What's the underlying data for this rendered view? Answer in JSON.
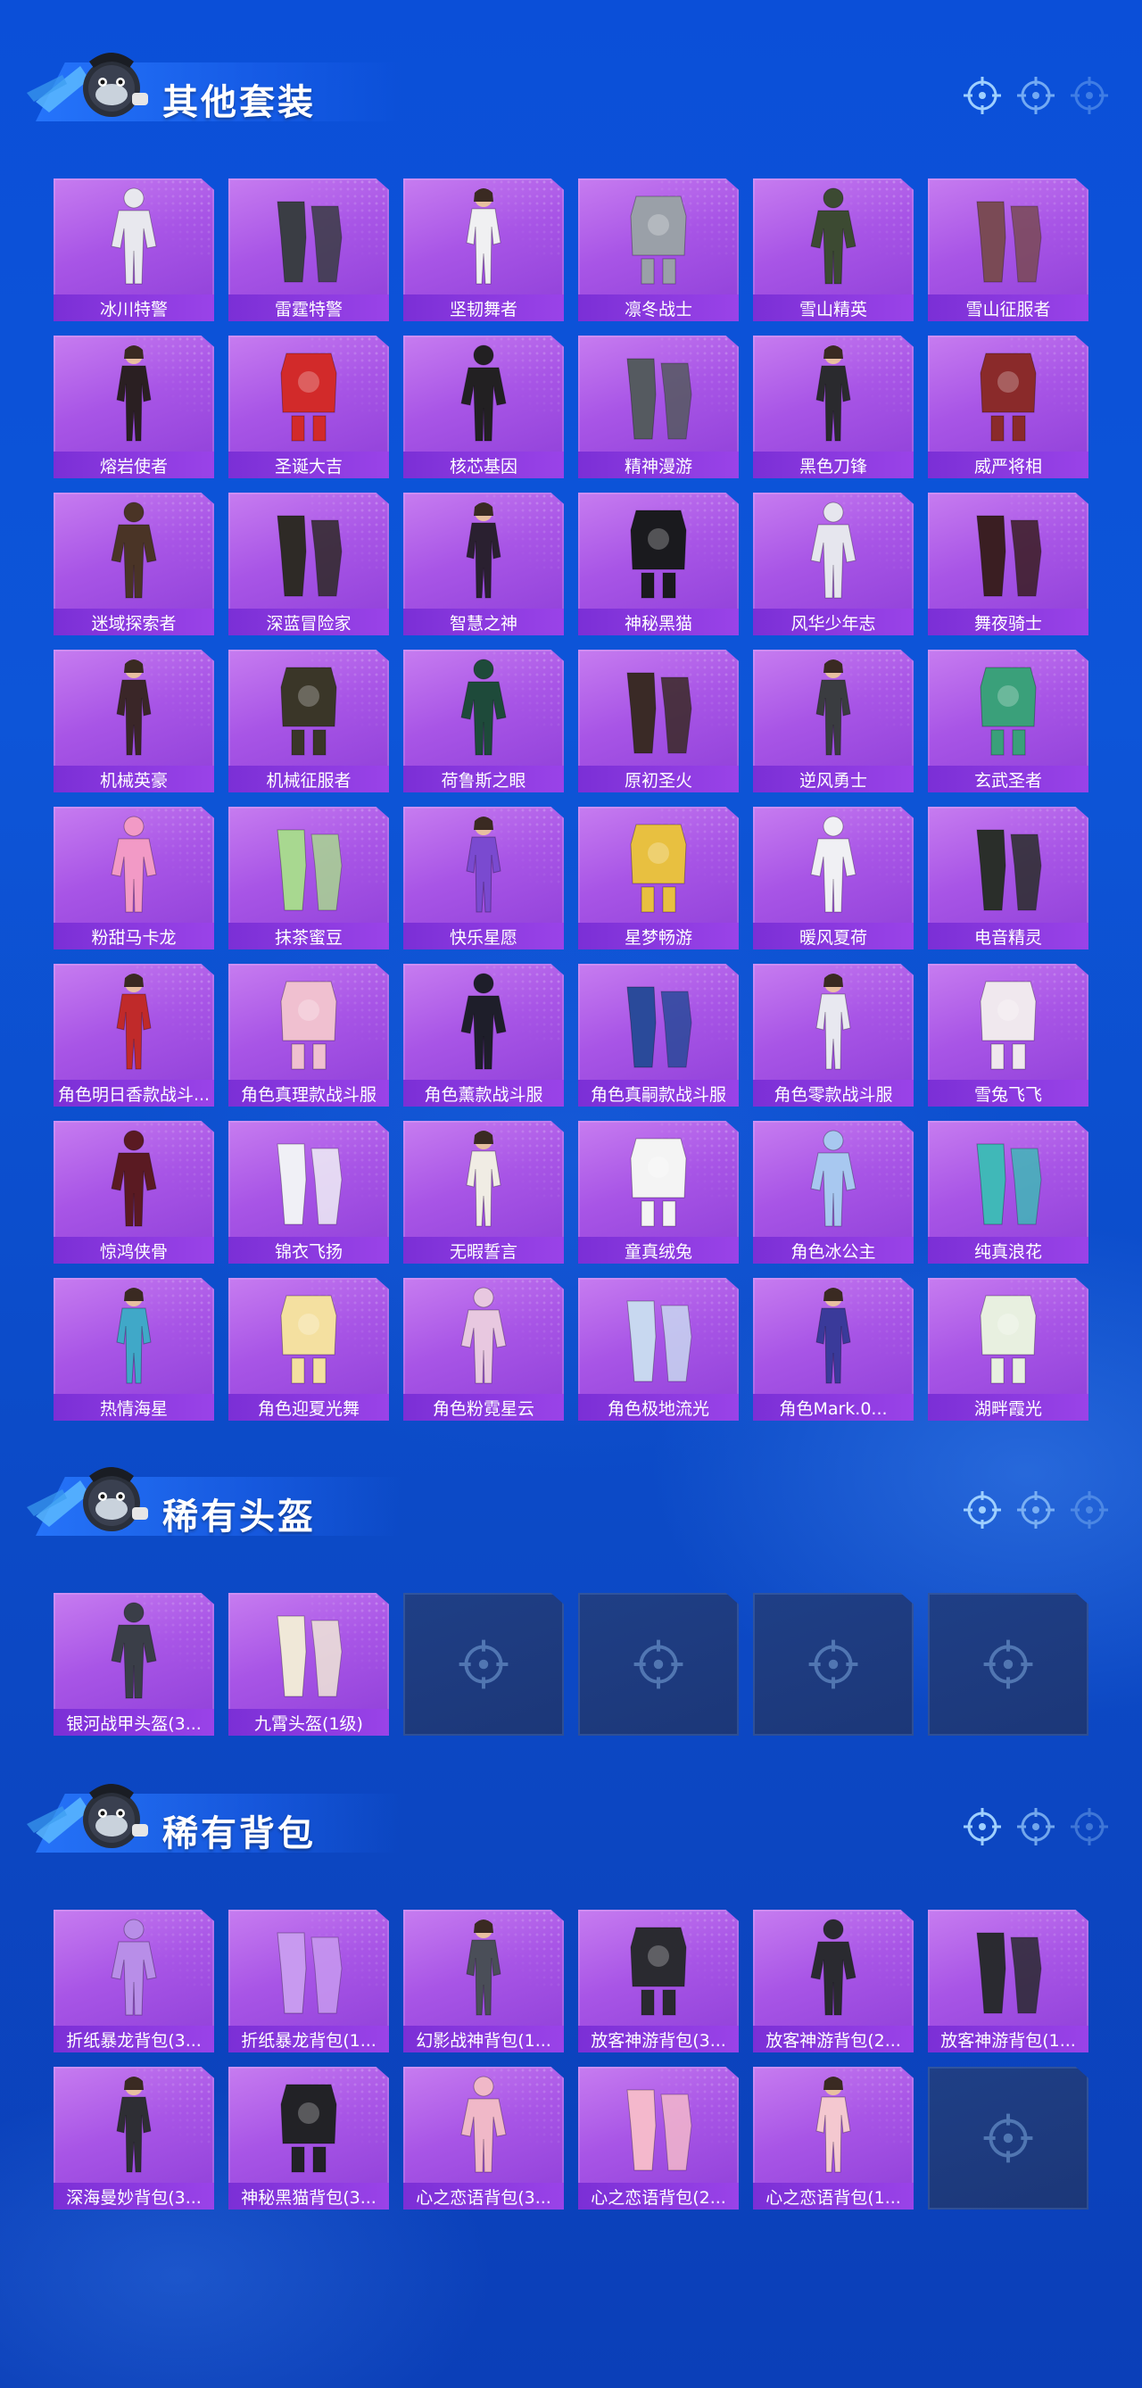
{
  "sections": [
    {
      "title": "其他套装",
      "items": [
        "冰川特警",
        "雷霆特警",
        "坚韧舞者",
        "凛冬战士",
        "雪山精英",
        "雪山征服者",
        "熔岩使者",
        "圣诞大吉",
        "核芯基因",
        "精神漫游",
        "黑色刀锋",
        "威严将相",
        "迷域探索者",
        "深蓝冒险家",
        "智慧之神",
        "神秘黑猫",
        "风华少年志",
        "舞夜骑士",
        "机械英豪",
        "机械征服者",
        "荷鲁斯之眼",
        "原初圣火",
        "逆风勇士",
        "玄武圣者",
        "粉甜马卡龙",
        "抹茶蜜豆",
        "快乐星愿",
        "星梦畅游",
        "暖风夏荷",
        "电音精灵",
        "角色明日香款战斗...",
        "角色真理款战斗服",
        "角色薰款战斗服",
        "角色真嗣款战斗服",
        "角色零款战斗服",
        "雪兔飞飞",
        "惊鸿侠骨",
        "锦衣飞扬",
        "无暇誓言",
        "童真绒兔",
        "角色冰公主",
        "纯真浪花",
        "热情海星",
        "角色迎夏光舞",
        "角色粉霓星云",
        "角色极地流光",
        "角色Mark.0...",
        "湖畔霞光"
      ],
      "colors": [
        "#e8e8ee",
        "#3a3d44",
        "#f0f0f2",
        "#9aa0a8",
        "#3c4a32",
        "#7a4a55",
        "#2a1f22",
        "#d22a2a",
        "#222022",
        "#555a60",
        "#2a2a2e",
        "#8a2a2a",
        "#4a3426",
        "#2e2a26",
        "#2a2030",
        "#1a1a1e",
        "#e6e6ee",
        "#3a1e22",
        "#3a2628",
        "#3a3628",
        "#1e4a3a",
        "#3a2a26",
        "#3a3c40",
        "#3aa07a",
        "#f29ac6",
        "#a8d890",
        "#7a4ad0",
        "#e8c040",
        "#f0f0f4",
        "#2a2e2a",
        "#c02a2a",
        "#f0c0d0",
        "#1e1e2a",
        "#2a4a9a",
        "#e8e8f0",
        "#f0e8ee",
        "#5a1a22",
        "#f0f0f6",
        "#f0ece4",
        "#f4f4f4",
        "#a8c8f0",
        "#40b8b8",
        "#40a8c8",
        "#f4e0a0",
        "#e8c8e0",
        "#c8d8f0",
        "#3a3a9a",
        "#e8f0e0"
      ]
    },
    {
      "title": "稀有头盔",
      "items": [
        "银河战甲头盔(3...",
        "九霄头盔(1级)",
        "",
        "",
        "",
        ""
      ],
      "colors": [
        "#3a3e48",
        "#f0e8d8",
        "",
        "",
        "",
        ""
      ]
    },
    {
      "title": "稀有背包",
      "items": [
        "折纸暴龙背包(3...",
        "折纸暴龙背包(1...",
        "幻影战神背包(1...",
        "放客神游背包(3...",
        "放客神游背包(2...",
        "放客神游背包(1...",
        "深海曼妙背包(3...",
        "神秘黑猫背包(3...",
        "心之恋语背包(3...",
        "心之恋语背包(2...",
        "心之恋语背包(1...",
        ""
      ],
      "colors": [
        "#b88ee8",
        "#c89af0",
        "#4a4e58",
        "#2a2a30",
        "#2a2a30",
        "#2a2a30",
        "#2e2e34",
        "#222226",
        "#f0b8c8",
        "#f4b8cc",
        "#f4c8d0",
        ""
      ]
    }
  ]
}
